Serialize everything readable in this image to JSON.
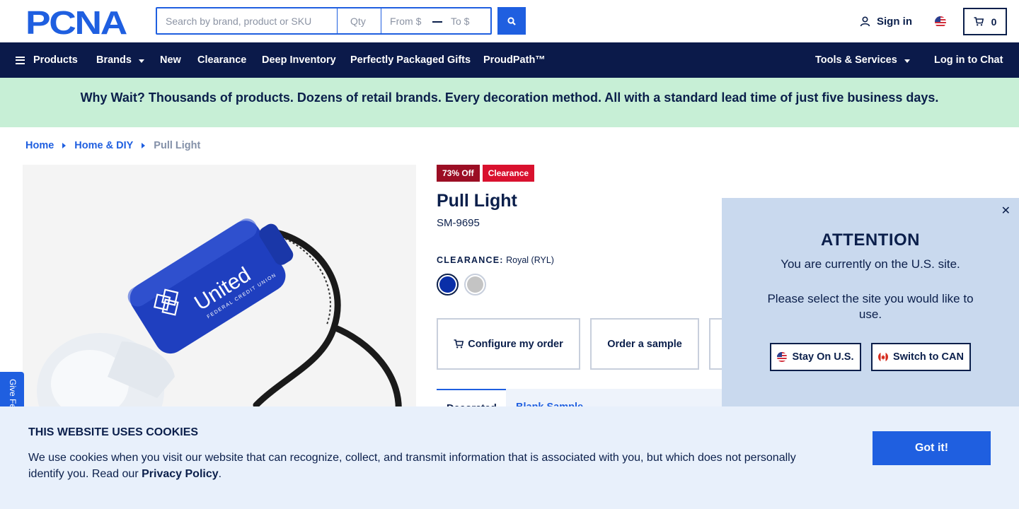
{
  "header": {
    "logo_text": "PCNA",
    "search": {
      "placeholder": "Search by brand, product or SKU",
      "qty_placeholder": "Qty",
      "from_placeholder": "From $",
      "to_placeholder": "To $"
    },
    "signin_label": "Sign in",
    "cart_count": "0"
  },
  "nav": {
    "products_label": "Products",
    "brands_label": "Brands",
    "new_label": "New",
    "clearance_label": "Clearance",
    "deep_inventory_label": "Deep Inventory",
    "gifts_label": "Perfectly Packaged Gifts",
    "proudpath_label": "ProudPath™",
    "tools_label": "Tools & Services",
    "chat_label": "Log in to Chat"
  },
  "banner": {
    "text": "Why Wait? Thousands of products. Dozens of retail brands. Every decoration method. All with a standard lead time of just five business days."
  },
  "breadcrumb": {
    "home": "Home",
    "category": "Home & DIY",
    "current": "Pull Light"
  },
  "product": {
    "badge_discount": "73% Off",
    "badge_clearance": "Clearance",
    "title": "Pull Light",
    "sku": "SM-9695",
    "color_label": "CLEARANCE:",
    "color_value": "Royal (RYL)",
    "swatches": [
      {
        "name": "Royal",
        "color": "#0a2fa8"
      },
      {
        "name": "Gray",
        "color": "#c4c4c4"
      }
    ],
    "image_imprint": "United",
    "image_imprint_sub": "FEDERAL CREDIT UNION",
    "configure_label": "Configure my order",
    "sample_label": "Order a sample",
    "tab_active_label": "Decorated",
    "tab_other_label": "Blank Sample"
  },
  "attention": {
    "title": "ATTENTION",
    "line1": "You are currently on the U.S. site.",
    "line2": "Please select the site you would like to use.",
    "stay_label": "Stay On U.S.",
    "switch_label": "Switch to CAN",
    "close_label": "✕"
  },
  "feedback_label": "Give Feedback",
  "cookie": {
    "title": "THIS WEBSITE USES COOKIES",
    "text": "We use cookies when you visit our website that can recognize, collect, and transmit information that is associated with you, but which does not personally identify you. Read our",
    "link": "Privacy Policy",
    "period": ".",
    "button": "Got it!"
  },
  "colors": {
    "brand_blue": "#1f5fe0",
    "navy": "#0b1a4a",
    "banner_green": "#c7efd6",
    "clearance_red": "#d9112e"
  }
}
